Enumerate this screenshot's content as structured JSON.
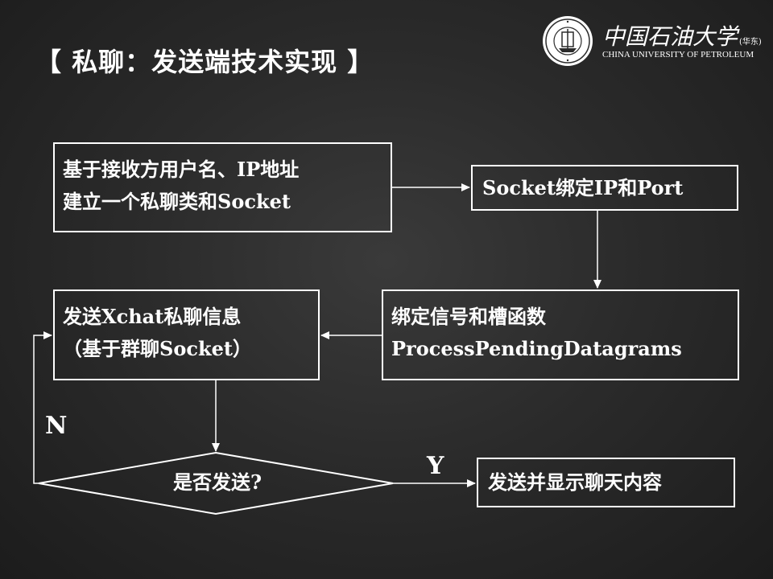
{
  "slide": {
    "title": "【 私聊：发送端技术实现 】"
  },
  "logo": {
    "cn_name": "中国石油大学",
    "cn_sub": "(华东)",
    "en_name": "CHINA UNIVERSITY OF PETROLEUM"
  },
  "flow": {
    "step1": {
      "line1": "基于接收方用户名、IP地址",
      "line2": "建立一个私聊类和Socket"
    },
    "step2": {
      "text": "Socket绑定IP和Port"
    },
    "step3": {
      "line1": "绑定信号和槽函数",
      "line2": "ProcessPendingDatagrams"
    },
    "step4": {
      "line1": "发送Xchat私聊信息",
      "line2": "（基于群聊Socket）"
    },
    "decision": {
      "text": "是否发送?"
    },
    "step5": {
      "text": "发送并显示聊天内容"
    },
    "label_no": "N",
    "label_yes": "Y"
  }
}
